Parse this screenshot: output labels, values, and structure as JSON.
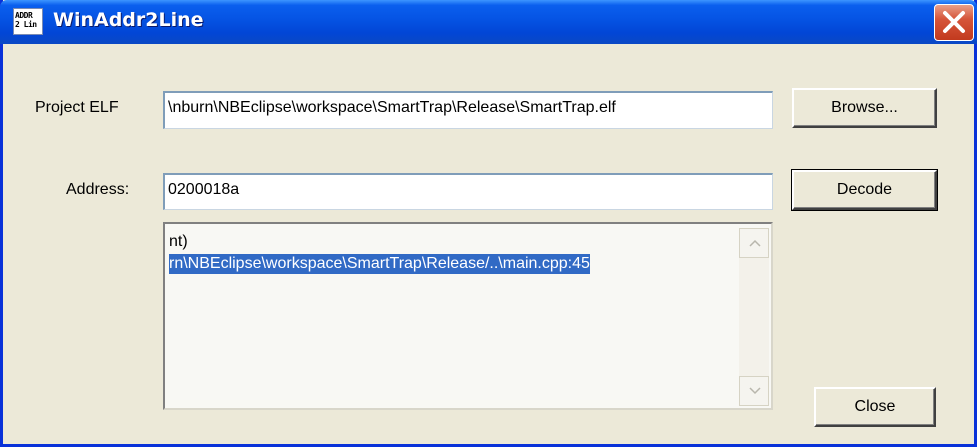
{
  "window": {
    "title": "WinAddr2Line",
    "icon_text": "ADDR\n2 Lin"
  },
  "project_elf": {
    "label": "Project ELF",
    "value": "\\nburn\\NBEclipse\\workspace\\SmartTrap\\Release\\SmartTrap.elf"
  },
  "address": {
    "label": "Address:",
    "value": "0200018a"
  },
  "buttons": {
    "browse": "Browse...",
    "decode": "Decode",
    "close": "Close"
  },
  "output": {
    "lines": [
      "nt)",
      "rn\\NBEclipse\\workspace\\SmartTrap\\Release/..\\main.cpp:45"
    ],
    "selected_index": 1
  },
  "colors": {
    "selection": "#316ac5",
    "titlebar": "#0553e3",
    "dialog_bg": "#ece9d8"
  },
  "icons": [
    "app-icon",
    "close-icon",
    "scroll-up-icon",
    "scroll-down-icon"
  ]
}
